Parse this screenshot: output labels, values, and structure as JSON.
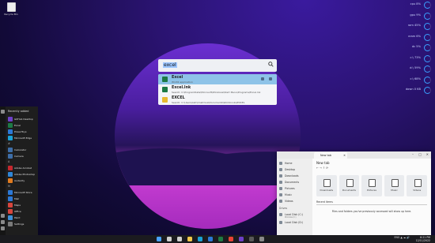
{
  "desktop": {
    "recycle_bin_label": "Recycle Bin"
  },
  "sysinfo": [
    {
      "label": "cpu 8%",
      "color": "#3aa0ff"
    },
    {
      "label": "gpu 9%",
      "color": "#3aa0ff"
    },
    {
      "label": "ram 45%",
      "color": "#3aa0ff"
    },
    {
      "label": "vram 6%",
      "color": "#3aa0ff"
    },
    {
      "label": "dc 5%",
      "color": "#3aa0ff"
    },
    {
      "label": "c:\\ 73%",
      "color": "#3aa0ff"
    },
    {
      "label": "d:\\ 59%",
      "color": "#3aa0ff"
    },
    {
      "label": "c:\\ 68%",
      "color": "#3aa0ff"
    },
    {
      "label": "down 0 KB",
      "color": "#3aa0ff"
    }
  ],
  "search": {
    "query": "excel",
    "icon": "search-icon",
    "results": [
      {
        "title": "Excel",
        "subtitle": "Win32 application",
        "icon": "excel-icon",
        "color": "#1d7a45",
        "selected": true
      },
      {
        "title": "Excel.lnk",
        "subtitle": "Search: C:\\ProgramData\\Microsoft\\Windows\\Start Menu\\Programs\\Excel.lnk",
        "icon": "excel-icon",
        "color": "#1d7a45",
        "selected": false
      },
      {
        "title": "EXCEL",
        "subtitle": "Search: C:\\Users\\Ash\\OneDrive\\Documents\\Workbooks\\EXCEL",
        "icon": "folder-icon",
        "color": "#e8b930",
        "selected": false
      }
    ]
  },
  "start_menu": {
    "heading": "Recently added",
    "items": [
      {
        "label": "GitHub Desktop",
        "color": "#6e40c9"
      },
      {
        "label": "Excel",
        "color": "#1d7a45"
      },
      {
        "label": "PowerToys",
        "color": "#2b78d6"
      },
      {
        "label": "Microsoft Edge",
        "color": "#1aa1d6"
      }
    ],
    "letters": [
      "#",
      "A",
      "C",
      "M"
    ],
    "more_items": [
      {
        "label": "Calculator",
        "color": "#3e6ea8"
      },
      {
        "label": "Camera",
        "color": "#3e6ea8"
      },
      {
        "label": "Adobe Acrobat",
        "color": "#c5282e"
      },
      {
        "label": "Adobe Photoshop",
        "color": "#2f86d6"
      },
      {
        "label": "Audacity",
        "color": "#e07b1f"
      },
      {
        "label": "Microsoft Store",
        "color": "#2b78d6"
      },
      {
        "label": "Mail",
        "color": "#2b78d6"
      },
      {
        "label": "Maps",
        "color": "#d6453d"
      },
      {
        "label": "Office",
        "color": "#d6453d"
      },
      {
        "label": "Paint",
        "color": "#3e8fd6"
      },
      {
        "label": "Settings",
        "color": "#7a7a7a"
      }
    ]
  },
  "explorer": {
    "tab_title": "New tab",
    "heading": "New tab",
    "toolbar": "←  →  ↑  ⟳",
    "sidebar": [
      {
        "label": "Home",
        "sub": ""
      },
      {
        "label": "Desktop",
        "sub": ""
      },
      {
        "label": "Downloads",
        "sub": ""
      },
      {
        "label": "Documents",
        "sub": ""
      },
      {
        "label": "Pictures",
        "sub": ""
      },
      {
        "label": "Music",
        "sub": ""
      },
      {
        "label": "Videos",
        "sub": ""
      }
    ],
    "drives_heading": "Drives",
    "drives": [
      {
        "label": "Local Disk (C:)",
        "sub": "Windows (C:)"
      },
      {
        "label": "Local Disk (D:)",
        "sub": ""
      }
    ],
    "quick_access": [
      {
        "label": "Downloads"
      },
      {
        "label": "Documents"
      },
      {
        "label": "Pictures"
      },
      {
        "label": "Music"
      },
      {
        "label": "Videos"
      }
    ],
    "recent_heading": "Recent items",
    "recent_empty": "Files and folders you've previously accessed will show up here."
  },
  "taskbar": {
    "icons": [
      {
        "name": "start-icon",
        "color": "#4aa3ff"
      },
      {
        "name": "search-icon",
        "color": "#d0d0d0"
      },
      {
        "name": "task-view-icon",
        "color": "#d0d0d0"
      },
      {
        "name": "file-explorer-icon",
        "color": "#f2c94c"
      },
      {
        "name": "edge-icon",
        "color": "#1aa1d6"
      },
      {
        "name": "store-icon",
        "color": "#2b78d6"
      },
      {
        "name": "excel-icon",
        "color": "#1d7a45"
      },
      {
        "name": "chrome-icon",
        "color": "#e94235"
      },
      {
        "name": "github-icon",
        "color": "#6e40c9"
      },
      {
        "name": "terminal-icon",
        "color": "#5a5a5a"
      },
      {
        "name": "settings-icon",
        "color": "#8a8a8a"
      }
    ],
    "tray": "ENG  ▲  ☁  🔊",
    "time": "6:21 PM",
    "date": "12/11/2022"
  }
}
